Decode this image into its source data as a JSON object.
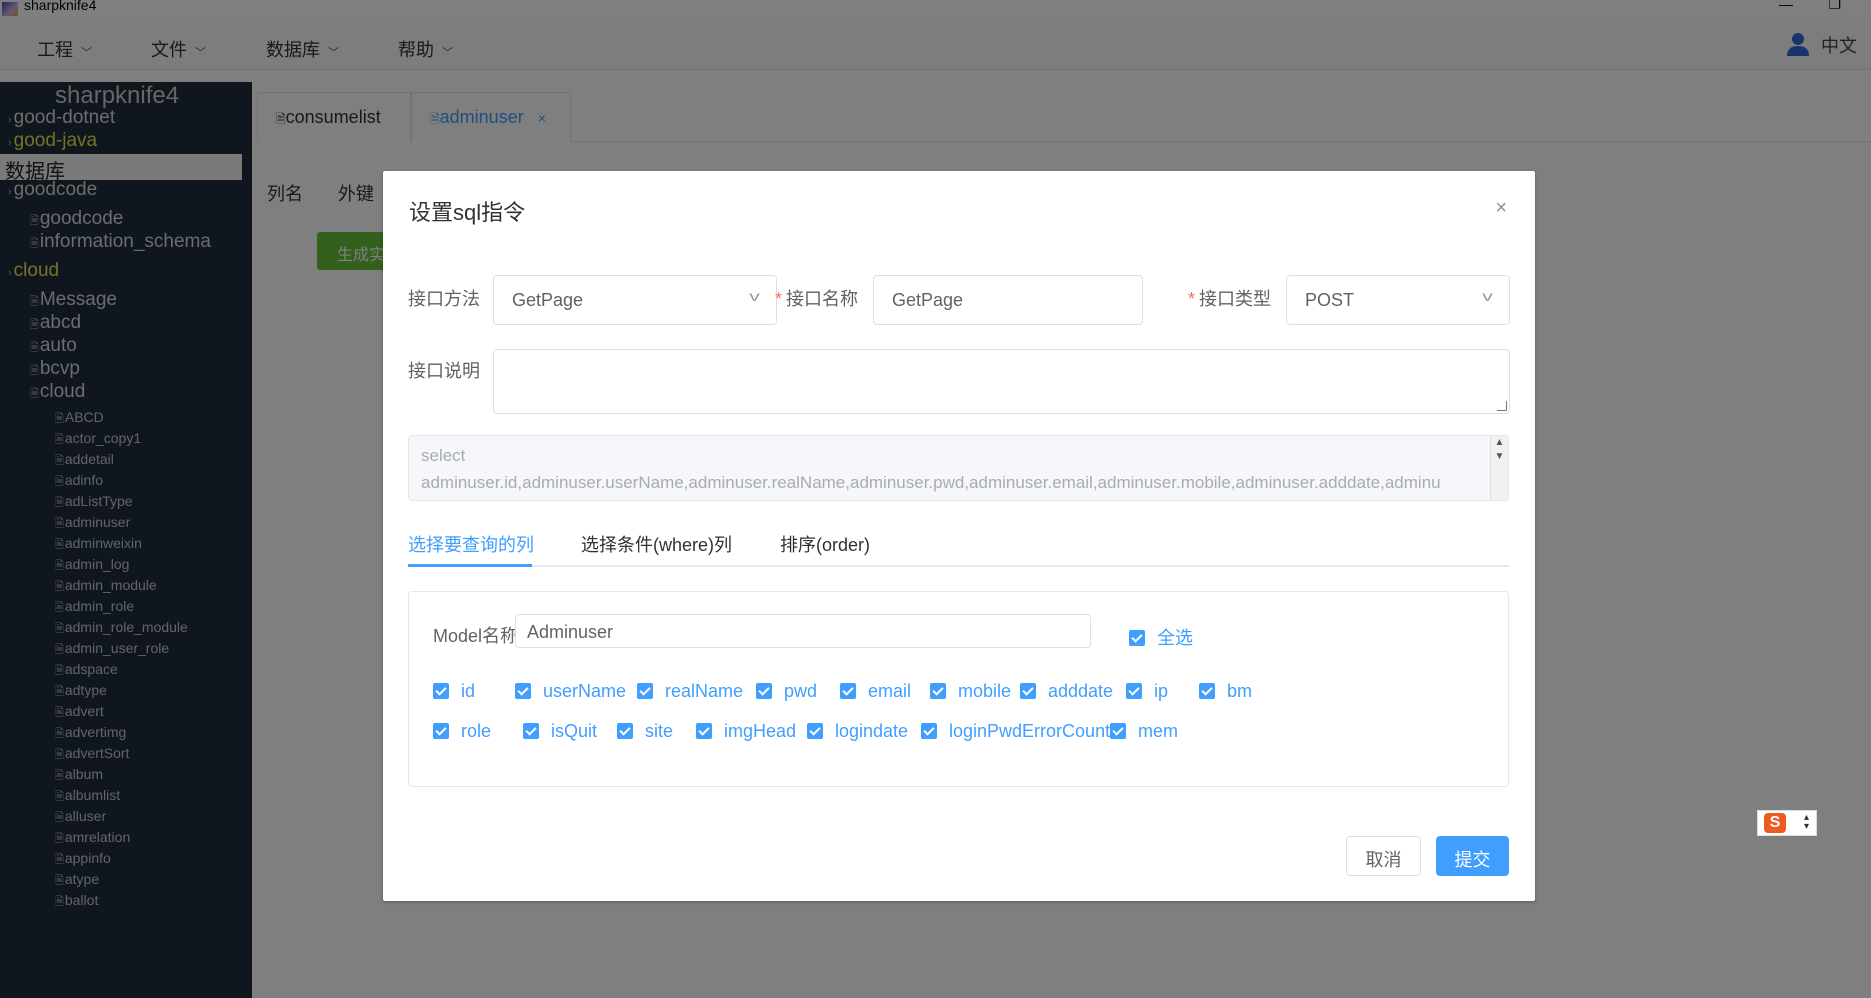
{
  "window": {
    "title": "sharpknife4",
    "minimize": "—",
    "restore": "❐"
  },
  "menu": {
    "items": [
      "工程",
      "文件",
      "数据库",
      "帮助"
    ],
    "lang": "中文"
  },
  "sidebar": {
    "brand": "sharpknife4",
    "active": "数据库",
    "top_items": [
      "good-dotnet",
      "good-java"
    ],
    "db_groups": [
      {
        "name": "goodcode",
        "children": [
          "goodcode",
          "information_schema"
        ]
      },
      {
        "name": "cloud",
        "children": [
          "Message",
          "abcd",
          "auto",
          "bcvp",
          "cloud"
        ]
      }
    ],
    "cloud_tables": [
      "ABCD",
      "actor_copy1",
      "addetail",
      "adinfo",
      "adListType",
      "adminuser",
      "adminweixin",
      "admin_log",
      "admin_module",
      "admin_role",
      "admin_role_module",
      "admin_user_role",
      "adspace",
      "adtype",
      "advert",
      "advertimg",
      "advertSort",
      "album",
      "albumlist",
      "alluser",
      "amrelation",
      "appinfo",
      "atype",
      "ballot"
    ]
  },
  "main": {
    "tabs": [
      {
        "label": "consumelist",
        "icon": "doc-icon"
      },
      {
        "label": "adminuser",
        "icon": "doc-icon",
        "close": "×"
      }
    ],
    "col_tabs": [
      "列名",
      "外键"
    ],
    "gen_button": "生成实"
  },
  "dialog": {
    "title": "设置sql指令",
    "close": "×",
    "method_label": "接口方法",
    "method_value": "GetPage",
    "name_label": "接口名称",
    "name_value": "GetPage",
    "type_label": "接口类型",
    "type_value": "POST",
    "desc_label": "接口说明",
    "desc_value": "",
    "sql_line1": "select",
    "sql_line2": "adminuser.id,adminuser.userName,adminuser.realName,adminuser.pwd,adminuser.email,adminuser.mobile,adminuser.adddate,adminu",
    "tabs": [
      "选择要查询的列",
      "选择条件(where)列",
      "排序(order)"
    ],
    "model_label": "Model名称",
    "model_value": "Adminuser",
    "select_all": "全选",
    "columns_row1": [
      "id",
      "userName",
      "realName",
      "pwd",
      "email",
      "mobile",
      "adddate",
      "ip",
      "bm"
    ],
    "columns_row2": [
      "role",
      "isQuit",
      "site",
      "imgHead",
      "logindate",
      "loginPwdErrorCount",
      "mem"
    ],
    "cancel": "取消",
    "submit": "提交"
  },
  "colors": {
    "primary": "#409eff",
    "sidebar_bg": "#1f2d3d",
    "success": "#67c23a",
    "required": "#f56c6c"
  }
}
